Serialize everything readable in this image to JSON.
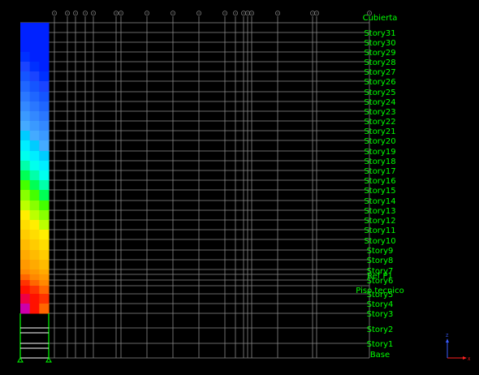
{
  "colors": {
    "background": "#000000",
    "grid_line": "#8a8a8a",
    "label_green": "#00ff00",
    "axis_red": "#ff2020",
    "axis_blue": "#3a5bff"
  },
  "grid_marker_symbol": "⊙",
  "axes": {
    "x_label": "X",
    "y_label": "Y",
    "z_label": "Z"
  },
  "stories": [
    {
      "label": "Cubierta"
    },
    {
      "label": "Story31"
    },
    {
      "label": "Story30"
    },
    {
      "label": "Story29"
    },
    {
      "label": "Story28"
    },
    {
      "label": "Story27"
    },
    {
      "label": "Story26"
    },
    {
      "label": "Story25"
    },
    {
      "label": "Story24"
    },
    {
      "label": "Story23"
    },
    {
      "label": "Story22"
    },
    {
      "label": "Story21"
    },
    {
      "label": "Story20"
    },
    {
      "label": "Story19"
    },
    {
      "label": "Story18"
    },
    {
      "label": "Story17"
    },
    {
      "label": "Story16"
    },
    {
      "label": "Story15"
    },
    {
      "label": "Story14"
    },
    {
      "label": "Story13"
    },
    {
      "label": "Story12"
    },
    {
      "label": "Story11"
    },
    {
      "label": "Story10"
    },
    {
      "label": "Story9"
    },
    {
      "label": "Story8"
    },
    {
      "label": "Story7"
    },
    {
      "label": "Ref P1"
    },
    {
      "label": "Story6"
    },
    {
      "label": "Piso tecnico"
    },
    {
      "label": "Story5"
    },
    {
      "label": "Story4"
    },
    {
      "label": "Story3"
    },
    {
      "label": "Story2"
    },
    {
      "label": "Story1"
    },
    {
      "label": "Base"
    }
  ],
  "column_bands": [
    {
      "colors": [
        "#0022ff",
        "#0022ff",
        "#0022ff"
      ]
    },
    {
      "colors": [
        "#0022ff",
        "#0022ff",
        "#0022ff"
      ]
    },
    {
      "colors": [
        "#0022ff",
        "#0022ff",
        "#0022ff"
      ]
    },
    {
      "colors": [
        "#0030ff",
        "#0022ff",
        "#0022ff"
      ]
    },
    {
      "colors": [
        "#1a44ff",
        "#0030ff",
        "#0022ff"
      ]
    },
    {
      "colors": [
        "#1555ff",
        "#1a44ff",
        "#0030ff"
      ]
    },
    {
      "colors": [
        "#1f66ff",
        "#1555ff",
        "#1a44ff"
      ]
    },
    {
      "colors": [
        "#2a77ff",
        "#1f66ff",
        "#1555ff"
      ]
    },
    {
      "colors": [
        "#3388ff",
        "#2a77ff",
        "#1f66ff"
      ]
    },
    {
      "colors": [
        "#3a99ff",
        "#3388ff",
        "#2a77ff"
      ]
    },
    {
      "colors": [
        "#44aaff",
        "#3a99ff",
        "#3388ff"
      ]
    },
    {
      "colors": [
        "#00ccff",
        "#44aaff",
        "#3a99ff"
      ]
    },
    {
      "colors": [
        "#00eeff",
        "#00ccff",
        "#44aaff"
      ]
    },
    {
      "colors": [
        "#00ffee",
        "#00eeff",
        "#00ccff"
      ]
    },
    {
      "colors": [
        "#00ffaa",
        "#00ffee",
        "#00eeff"
      ]
    },
    {
      "colors": [
        "#00ff55",
        "#00ffaa",
        "#00ffee"
      ]
    },
    {
      "colors": [
        "#44ff00",
        "#00ff55",
        "#00ffaa"
      ]
    },
    {
      "colors": [
        "#88ff00",
        "#44ff00",
        "#00ff55"
      ]
    },
    {
      "colors": [
        "#bbff00",
        "#88ff00",
        "#44ff00"
      ]
    },
    {
      "colors": [
        "#ffee00",
        "#bbff00",
        "#88ff00"
      ]
    },
    {
      "colors": [
        "#ffdd00",
        "#ffee00",
        "#bbff00"
      ]
    },
    {
      "colors": [
        "#ffcc00",
        "#ffdd00",
        "#ffee00"
      ]
    },
    {
      "colors": [
        "#ffbb00",
        "#ffcc00",
        "#ffdd00"
      ]
    },
    {
      "colors": [
        "#ffaa00",
        "#ffbb00",
        "#ffcc00"
      ]
    },
    {
      "colors": [
        "#ff9900",
        "#ffaa00",
        "#ffbb00"
      ]
    },
    {
      "colors": [
        "#ff8800",
        "#ff9900",
        "#ffaa00"
      ]
    },
    {
      "colors": [
        "#ff6600",
        "#ff8800",
        "#ff9900"
      ]
    },
    {
      "colors": [
        "#ff3300",
        "#ff6600",
        "#ff8800"
      ]
    },
    {
      "colors": [
        "#ff1100",
        "#ff3300",
        "#ff6600"
      ]
    },
    {
      "colors": [
        "#ee0044",
        "#ff1100",
        "#ff3300"
      ]
    },
    {
      "colors": [
        "#cc00aa",
        "#ff1100",
        "#ff6600"
      ]
    }
  ]
}
